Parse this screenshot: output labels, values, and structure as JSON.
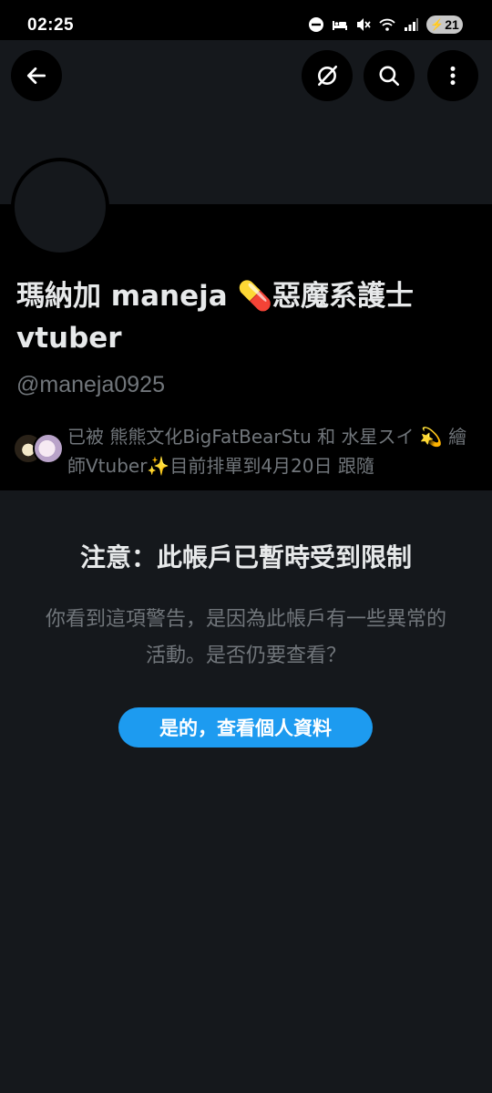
{
  "status_bar": {
    "time": "02:25",
    "battery": "21",
    "icons": [
      "dnd-icon",
      "sleep-icon",
      "mute-icon",
      "wifi-5g-icon",
      "signal-icon",
      "battery-icon"
    ]
  },
  "header": {
    "back_icon": "arrow-left-icon",
    "actions": [
      "grok-icon",
      "search-icon",
      "more-vertical-icon"
    ]
  },
  "profile": {
    "display_name": "瑪納加 maneja 💊惡魔系護士vtuber",
    "handle": "@maneja0925",
    "followed_by": "已被 熊熊文化BigFatBearStu 和 水星スイ 💫 繪師Vtuber✨目前排單到4月20日 跟隨"
  },
  "warning": {
    "title": "注意：此帳戶已暫時受到限制",
    "body": "你看到這項警告，是因為此帳戶有一些異常的活動。是否仍要查看？",
    "button_label": "是的，查看個人資料"
  },
  "colors": {
    "background": "#15181c",
    "profile_bg": "#000000",
    "accent": "#1d9bf0",
    "secondary_text": "#71767b"
  }
}
